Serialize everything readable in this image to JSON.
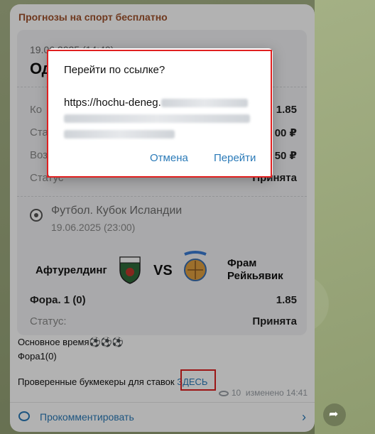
{
  "channel": {
    "name": "Прогнозы на спорт бесплатно"
  },
  "ticket": {
    "date": "19.06.2025 (14:40)",
    "title": "Од",
    "rows": [
      {
        "label": "Ко",
        "value": "1.85"
      },
      {
        "label": "Ста",
        "value": "00 ₽"
      },
      {
        "label": "Воз",
        "value": "50 ₽"
      },
      {
        "label": "Статус",
        "value": "Принята"
      }
    ],
    "match": {
      "name": "Футбол. Кубок Исландии",
      "date": "19.06.2025 (23:00)",
      "team_home": "Афтурелдинг",
      "vs": "VS",
      "team_away_line1": "Фрам",
      "team_away_line2": "Рейкьявик",
      "bet_label": "Фора. 1 (0)",
      "bet_value": "1.85",
      "status_label": "Статус:",
      "status_value": "Принята"
    }
  },
  "message": {
    "line1": "Основное время⚽⚽⚽",
    "line2": "Фора1(0)",
    "line3_prefix": "Проверенные букмекеры для ставок ",
    "line3_link": "ЗДЕСЬ",
    "views": "10",
    "edited": "изменено 14:41"
  },
  "comment": {
    "label": "Прокомментировать"
  },
  "dialog": {
    "title": "Перейти по ссылке?",
    "url_visible": "https://hochu-deneg.",
    "cancel": "Отмена",
    "confirm": "Перейти"
  },
  "colors": {
    "accent": "#2a7ab8",
    "highlight": "#e02020",
    "channel": "#a0522d"
  }
}
